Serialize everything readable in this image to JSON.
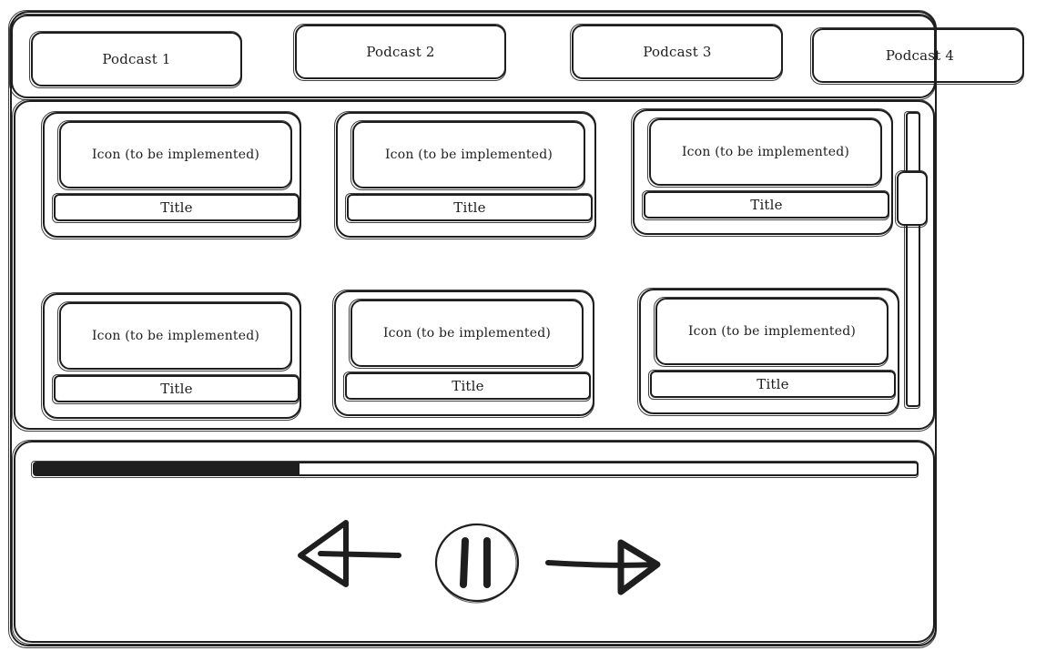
{
  "tabs": [
    {
      "label": "Podcast 1"
    },
    {
      "label": "Podcast 2"
    },
    {
      "label": "Podcast 3"
    },
    {
      "label": "Podcast 4"
    }
  ],
  "cards": [
    {
      "icon_text": "Icon (to be implemented)",
      "title": "Title"
    },
    {
      "icon_text": "Icon (to be implemented)",
      "title": "Title"
    },
    {
      "icon_text": "Icon (to be implemented)",
      "title": "Title"
    },
    {
      "icon_text": "Icon (to be implemented)",
      "title": "Title"
    },
    {
      "icon_text": "Icon (to be implemented)",
      "title": "Title"
    },
    {
      "icon_text": "Icon (to be implemented)",
      "title": "Title"
    }
  ],
  "player": {
    "progress_fraction": 0.3,
    "controls": [
      "previous-arrow-icon",
      "pause-icon",
      "next-arrow-icon"
    ]
  },
  "colors": {
    "ink": "#1e1e1e",
    "background": "#ffffff"
  }
}
